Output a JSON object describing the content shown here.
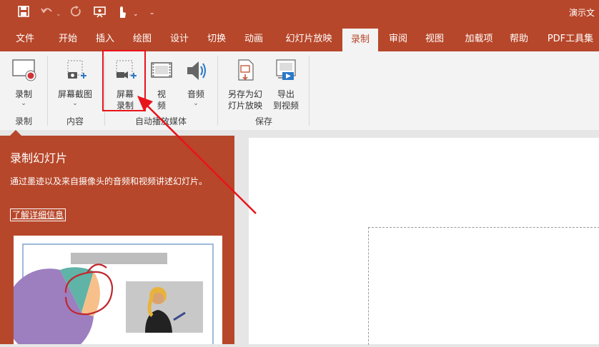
{
  "window": {
    "doc_title": "演示文"
  },
  "quick_access": [
    "save-icon",
    "undo-icon",
    "redo-icon",
    "present-icon",
    "touch-icon",
    "customize-icon"
  ],
  "tabs": [
    {
      "label": "文件",
      "active": false
    },
    {
      "label": "开始",
      "active": false
    },
    {
      "label": "插入",
      "active": false
    },
    {
      "label": "绘图",
      "active": false
    },
    {
      "label": "设计",
      "active": false
    },
    {
      "label": "切换",
      "active": false
    },
    {
      "label": "动画",
      "active": false
    },
    {
      "label": "幻灯片放映",
      "active": false
    },
    {
      "label": "录制",
      "active": true
    },
    {
      "label": "审阅",
      "active": false
    },
    {
      "label": "视图",
      "active": false
    },
    {
      "label": "加载项",
      "active": false
    },
    {
      "label": "帮助",
      "active": false
    },
    {
      "label": "PDF工具集",
      "active": false
    }
  ],
  "ribbon": {
    "record": {
      "label": "录制",
      "group": "录制"
    },
    "screenshot": {
      "label": "屏幕截图",
      "group": "内容"
    },
    "screen_record": {
      "label_line1": "屏幕",
      "label_line2": "录制"
    },
    "video": {
      "label_line1": "视",
      "label_line2": "频"
    },
    "audio": {
      "label": "音频"
    },
    "automedia_group": "自动播放媒体",
    "save_as_show": {
      "label_line1": "另存为幻",
      "label_line2": "灯片放映"
    },
    "export_video": {
      "label_line1": "导出",
      "label_line2": "到视频"
    },
    "save_group": "保存"
  },
  "tooltip": {
    "title": "录制幻灯片",
    "description": "通过墨迹以及来自摄像头的音频和视频讲述幻灯片。",
    "link": "了解详细信息"
  },
  "colors": {
    "brand": "#b7472a",
    "ribbon_bg": "#f3f3f3",
    "annotation": "#e8141b"
  }
}
